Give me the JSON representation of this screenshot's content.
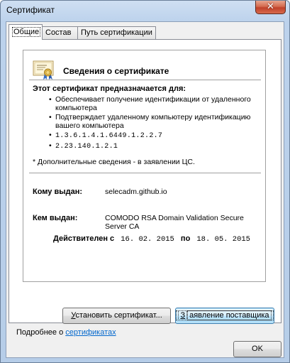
{
  "window": {
    "title": "Сертификат",
    "close_glyph": "✕"
  },
  "tabs": [
    {
      "label": "Общие",
      "active": true
    },
    {
      "label": "Состав",
      "active": false
    },
    {
      "label": "Путь сертификации",
      "active": false
    }
  ],
  "certificate": {
    "header": "Сведения о сертификате",
    "purpose_title": "Этот сертификат предназначается для:",
    "purposes": [
      "Обеспечивает получение идентификации от удаленного компьютера",
      "Подтверждает удаленному компьютеру идентификацию вашего компьютера",
      "1.3.6.1.4.1.6449.1.2.2.7",
      "2.23.140.1.2.1"
    ],
    "bullet": "•",
    "note": "* Дополнительные сведения - в заявлении ЦС.",
    "issued_to_label": "Кому выдан:",
    "issued_to_value": "selecadm.github.io",
    "issued_by_label": "Кем выдан:",
    "issued_by_value": "COMODO RSA Domain Validation Secure Server CA",
    "valid_from_label": "Действителен с",
    "valid_from": "16. 02. 2015",
    "valid_to_label": "по",
    "valid_to": "18. 05. 2015"
  },
  "buttons": {
    "install": "Установить сертификат...",
    "install_mnemonic": "У",
    "install_rest": "становить сертификат...",
    "statement": "Заявление поставщика",
    "statement_mnemonic": "З",
    "statement_rest": "аявление поставщика",
    "ok": "OK"
  },
  "footer": {
    "more_prefix": "Подробнее о ",
    "more_link": "сертификатах"
  }
}
